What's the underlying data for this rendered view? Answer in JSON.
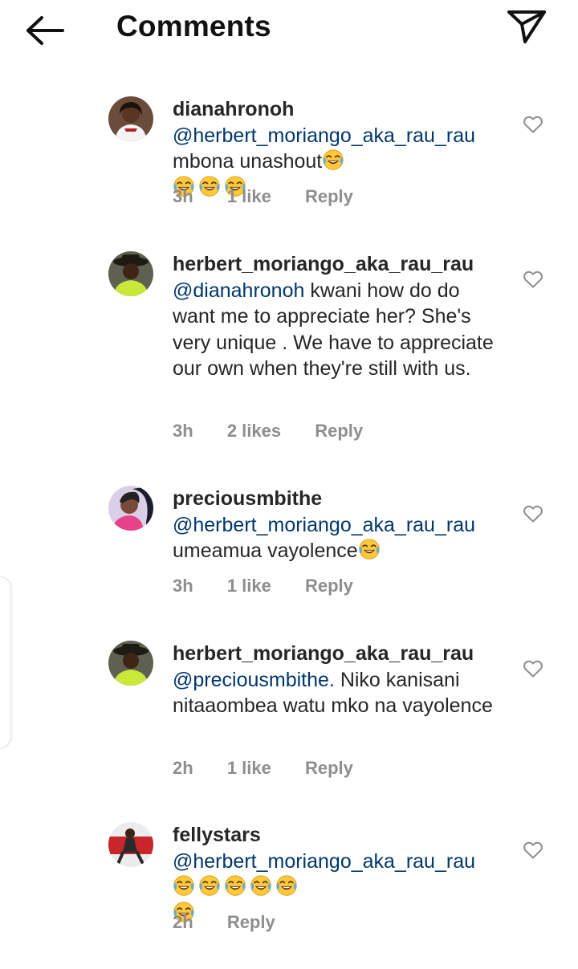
{
  "header": {
    "title": "Comments",
    "back_icon": "arrow-left-icon",
    "share_icon": "paper-plane-icon"
  },
  "colors": {
    "mention": "#00376b",
    "meta": "#8e8e8e",
    "text": "#262626"
  },
  "comments": [
    {
      "username": "dianahronoh",
      "mention": "@herbert_moriango_aka_rau_rau",
      "text": "mbona unashout",
      "emoji_count_inline": 1,
      "emoji_count_after": 3,
      "time": "3h",
      "likes": "1 like",
      "reply": "Reply"
    },
    {
      "username": "herbert_moriango_aka_rau_rau",
      "mention": "@dianahronoh",
      "text": "kwani how do do want me to appreciate her? She's very unique . We have to appreciate our own when they're still with us.",
      "time": "3h",
      "likes": "2 likes",
      "reply": "Reply"
    },
    {
      "username": "preciousmbithe",
      "mention": "@herbert_moriango_aka_rau_rau",
      "text": "umeamua vayolence",
      "time": "3h",
      "likes": "1 like",
      "reply": "Reply"
    },
    {
      "username": "herbert_moriango_aka_rau_rau",
      "mention": "@preciousmbithe.",
      "text": "Niko kanisani nitaaombea watu mko na vayolence",
      "time": "2h",
      "likes": "1 like",
      "reply": "Reply"
    },
    {
      "username": "fellystars",
      "mention": "@herbert_moriango_aka_rau_rau",
      "text": "",
      "time": "2h",
      "reply": "Reply"
    }
  ]
}
